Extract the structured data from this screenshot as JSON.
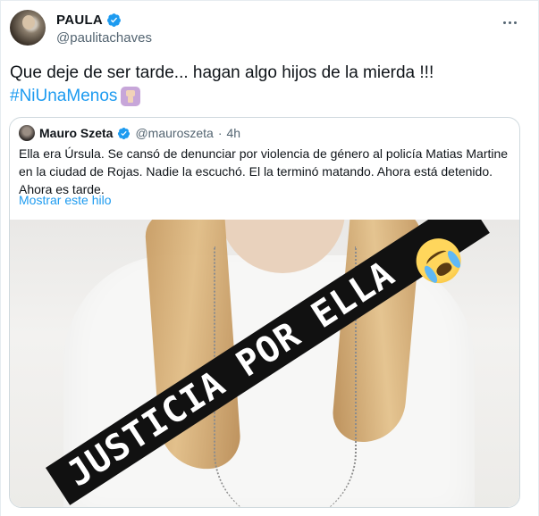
{
  "tweet": {
    "display_name": "PAULA",
    "handle": "@paulitachaves",
    "text": "Que deje de ser tarde... hagan algo hijos de la mierda !!!",
    "hashtag": "#NiUnaMenos"
  },
  "quote": {
    "display_name": "Mauro Szeta",
    "handle": "@mauroszeta",
    "separator": "·",
    "time": "4h",
    "text": "Ella era Úrsula. Se cansó de denunciar por violencia de género al policía Matias Martine en la ciudad de Rojas. Nadie la escuchó. El la terminó matando. Ahora está detenido. Ahora es tarde.",
    "thread_link": "Mostrar este hilo",
    "media_overlay_text": "JUSTICIA POR ELLA"
  },
  "colors": {
    "accent": "#1d9bf0",
    "text_primary": "#0f1419",
    "text_secondary": "#536471",
    "border": "#cfd9de"
  },
  "icons": {
    "verified": "verified-badge-icon",
    "more": "more-options-icon",
    "hashtag_emoji": "raised-fist-emoji-icon",
    "crying_emoji": "loudly-crying-face-emoji-icon"
  }
}
